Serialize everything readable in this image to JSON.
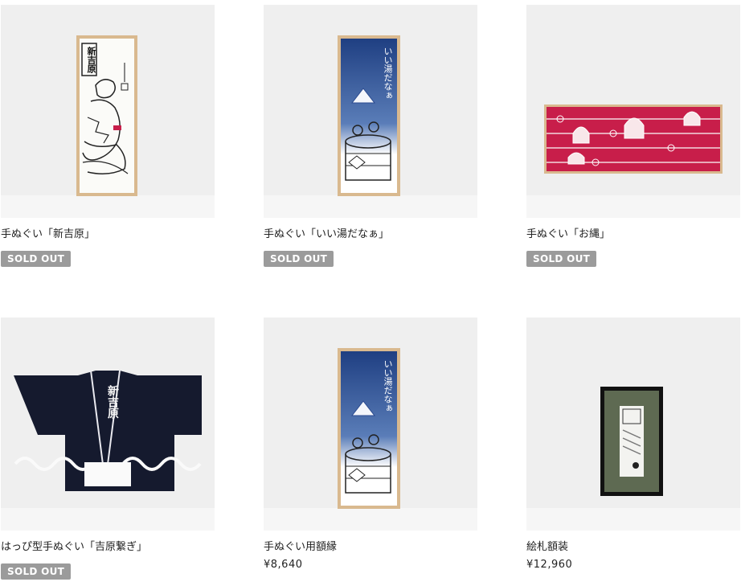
{
  "products": [
    {
      "title": "手ぬぐい「新吉原」",
      "badge": "SOLD OUT",
      "price": null,
      "art_text": "新吉原",
      "art_sub": "⊕"
    },
    {
      "title": "手ぬぐい「いい湯だなぁ」",
      "badge": "SOLD OUT",
      "price": null,
      "art_text": "いい湯だなぁ"
    },
    {
      "title": "手ぬぐい「お縄」",
      "badge": "SOLD OUT",
      "price": null
    },
    {
      "title": "はっぴ型手ぬぐい「吉原繋ぎ」",
      "badge": "SOLD OUT",
      "price": null,
      "art_text": "新吉原"
    },
    {
      "title": "手ぬぐい用額縁",
      "badge": null,
      "price": "¥8,640",
      "art_text": "いい湯だなぁ"
    },
    {
      "title": "絵札額装",
      "badge": null,
      "price": "¥12,960"
    }
  ],
  "colors": {
    "sold_out_badge": "#9b9b9b",
    "frame_wood": "#d9b98f",
    "indigo": "#1f3f82",
    "crimson": "#c81e4a",
    "hanten_navy": "#151a2e",
    "mat_green": "#5e6a52"
  }
}
